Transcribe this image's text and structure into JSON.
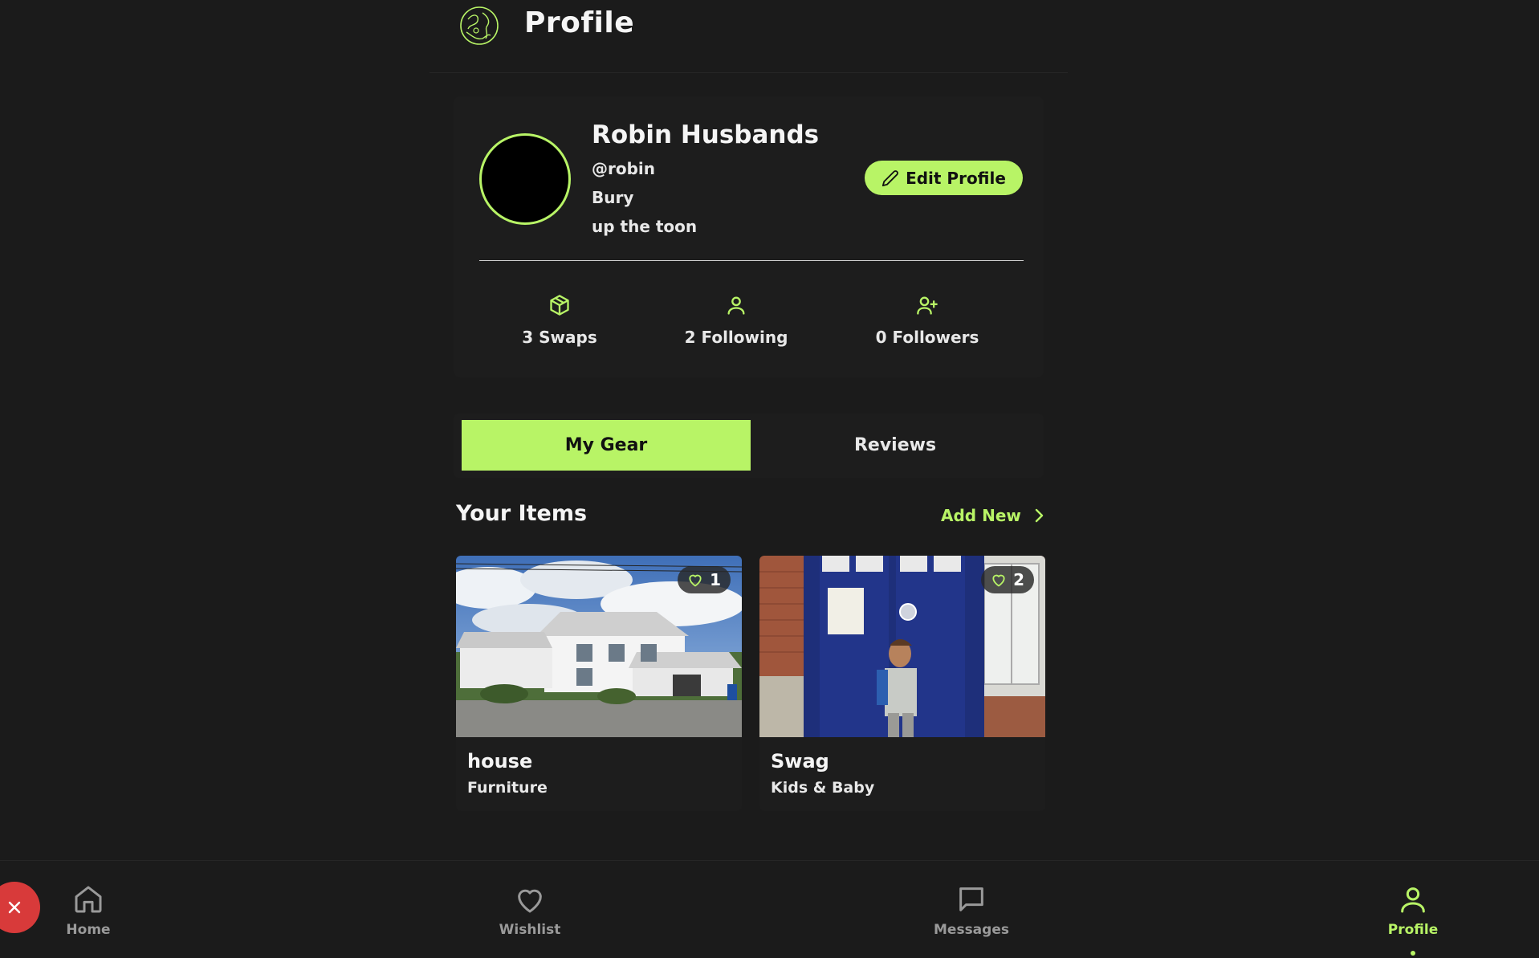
{
  "header": {
    "title": "Profile",
    "logo_icon": "globe-hands-icon"
  },
  "profile": {
    "name": "Robin Husbands",
    "handle": "@robin",
    "location": "Bury",
    "bio": "up the toon",
    "edit_label": "Edit Profile"
  },
  "stats": [
    {
      "icon": "box-icon",
      "label": "3 Swaps"
    },
    {
      "icon": "user-icon",
      "label": "2 Following"
    },
    {
      "icon": "user-plus-icon",
      "label": "0 Followers"
    }
  ],
  "tabs": [
    {
      "label": "My Gear",
      "active": true
    },
    {
      "label": "Reviews",
      "active": false
    }
  ],
  "items_section": {
    "title": "Your Items",
    "add_new_label": "Add New"
  },
  "items": [
    {
      "title": "house",
      "category": "Furniture",
      "likes": "1"
    },
    {
      "title": "Swag",
      "category": "Kids & Baby",
      "likes": "2"
    }
  ],
  "nav": [
    {
      "label": "Home",
      "icon": "home-icon",
      "active": false
    },
    {
      "label": "Wishlist",
      "icon": "heart-icon",
      "active": false
    },
    {
      "label": "Messages",
      "icon": "message-icon",
      "active": false
    },
    {
      "label": "Profile",
      "icon": "user-icon",
      "active": true
    }
  ],
  "colors": {
    "accent": "#b8f466",
    "background": "#1b1b1b",
    "danger": "#d83a3a"
  }
}
